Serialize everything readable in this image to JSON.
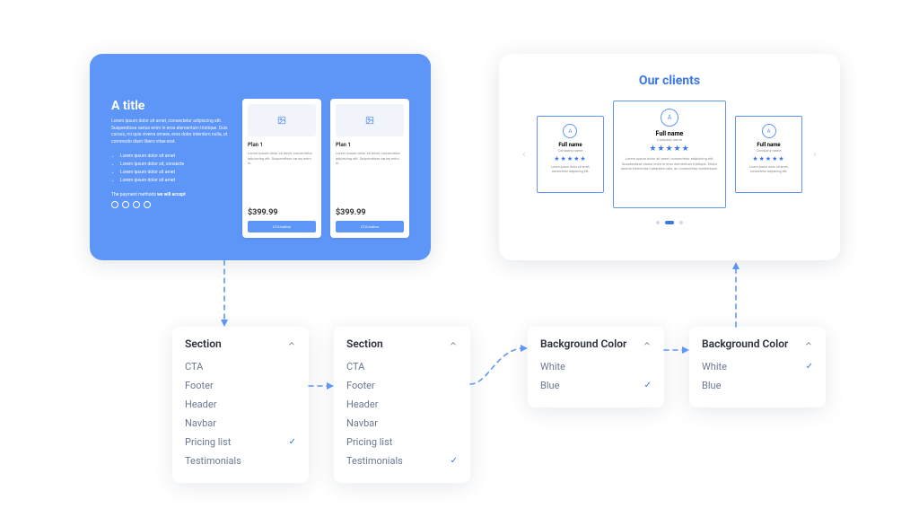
{
  "preview_left": {
    "title": "A title",
    "lorem": "Lorem ipsum dolor sit amet, consectetur adipiscing elit. Suspendisse varius enim in eros elementum tristique. Duis cursus, mi quis viverra ornare, eros dolor interdum nulla, ut commodo diam libero vitae erat.",
    "bullets": [
      "Lorem ipsum dolor sit amet",
      "Lorem ipsum dolor sit, consecte",
      "Lorem ipsum dolor sit amet",
      "Lorem ipsum dolor sit amet"
    ],
    "payment_prefix": "The payment methods ",
    "payment_bold": "we will accept",
    "plans": [
      {
        "name": "Plan 1",
        "lorem": "Lorem ipsum dolor sit amet, consectetur adipiscing elit. Suspendisse varius enim in.",
        "price": "$399.99",
        "cta": "CTA button"
      },
      {
        "name": "Plan 1",
        "lorem": "Lorem ipsum dolor sit amet, consectetur adipiscing elit. Suspendisse varius enim in.",
        "price": "$399.99",
        "cta": "CTA button"
      }
    ]
  },
  "preview_right": {
    "title": "Our clients",
    "avatar_letter": "A",
    "testimonials": [
      {
        "name": "Full name",
        "company": "Company name",
        "lorem": "Lorem ipsum dolor sit amet, consectetur adipiscing elit."
      },
      {
        "name": "Full name",
        "company": "Company name",
        "lorem": "Lorem ipsum dolor sit amet, consectetur adipiscing elit. Suspendisse varius enim in eros elementum tristique. Etiam lacinia elementum pharetra odio, ac consectetur scelerisque."
      },
      {
        "name": "Full name",
        "company": "Company name",
        "lorem": "Lorem ipsum dolor sit amet, consectetur adipiscing elit."
      }
    ]
  },
  "panels": [
    {
      "title": "Section",
      "options": [
        {
          "label": "CTA",
          "selected": false
        },
        {
          "label": "Footer",
          "selected": false
        },
        {
          "label": "Header",
          "selected": false
        },
        {
          "label": "Navbar",
          "selected": false
        },
        {
          "label": "Pricing list",
          "selected": true
        },
        {
          "label": "Testimonials",
          "selected": false
        }
      ]
    },
    {
      "title": "Section",
      "options": [
        {
          "label": "CTA",
          "selected": false
        },
        {
          "label": "Footer",
          "selected": false
        },
        {
          "label": "Header",
          "selected": false
        },
        {
          "label": "Navbar",
          "selected": false
        },
        {
          "label": "Pricing list",
          "selected": false
        },
        {
          "label": "Testimonials",
          "selected": true
        }
      ]
    },
    {
      "title": "Background Color",
      "options": [
        {
          "label": "White",
          "selected": false
        },
        {
          "label": "Blue",
          "selected": true
        }
      ]
    },
    {
      "title": "Background Color",
      "options": [
        {
          "label": "White",
          "selected": true
        },
        {
          "label": "Blue",
          "selected": false
        }
      ]
    }
  ]
}
